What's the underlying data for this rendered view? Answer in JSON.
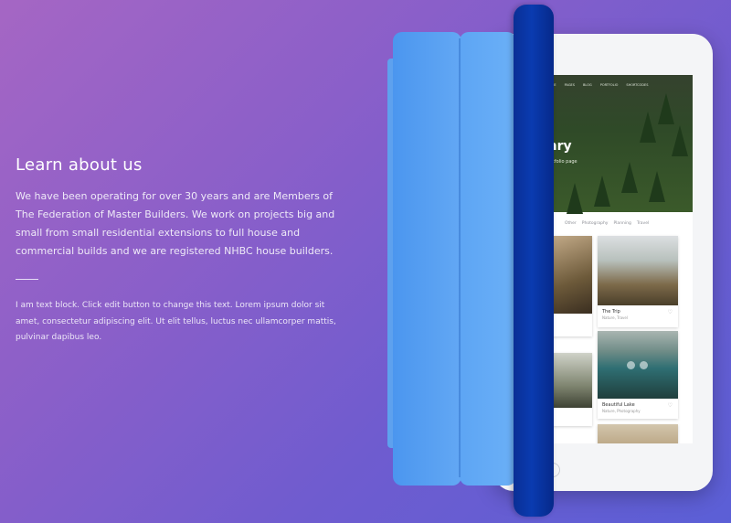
{
  "about": {
    "heading": "Learn about us",
    "lead": "We have been operating for over 30 years and are Members of The Federation of Master Builders. We work on projects big and small from small residential extensions to full house and commercial builds and we are registered NHBC house builders.",
    "body": "I am text block. Click edit button to change this text. Lorem ipsum dolor sit amet, consectetur adipiscing elit. Ut elit tellus, luctus nec ullamcorper mattis, pulvinar dapibus leo."
  },
  "device_screen": {
    "nav": [
      "HOME",
      "PAGES",
      "BLOG",
      "PORTFOLIO",
      "SHORTCODES"
    ],
    "hero_title": "onry",
    "hero_subtitle": "r portfolio page",
    "filters": [
      "Other",
      "Photography",
      "Planning",
      "Travel"
    ],
    "cards": [
      {
        "title": "The Trip",
        "meta": "Nature, Travel",
        "likes": "198"
      },
      {
        "title": "Beautiful Lake",
        "meta": "Nature, Photography",
        "likes": "133"
      }
    ]
  },
  "colors": {
    "bg_start": "#a566c4",
    "bg_end": "#5b5fd6",
    "cover_light": "#5ea1ee",
    "cover_dark": "#0a3bb0"
  }
}
